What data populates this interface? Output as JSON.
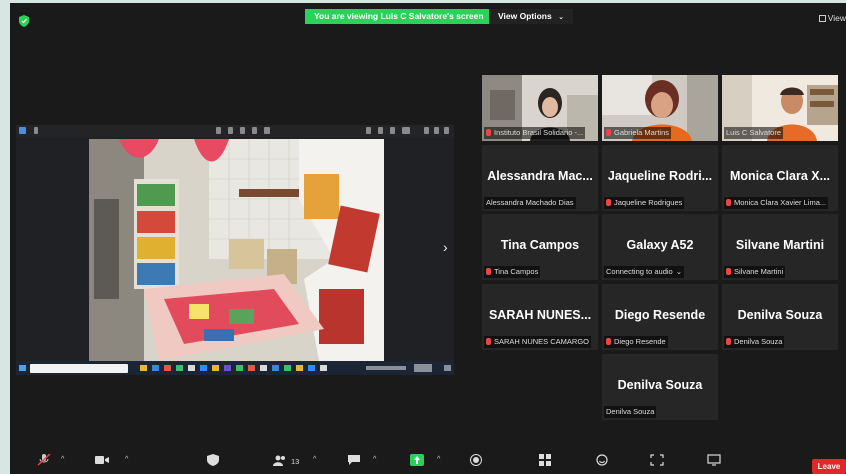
{
  "top_bar": {
    "viewing_banner": "You are viewing Luis C Salvatore's screen",
    "view_options": "View Options",
    "view_button": "View"
  },
  "participants": [
    {
      "big_name": "",
      "label": "Instituto Brasil Solidario -...",
      "muted": true,
      "video": true
    },
    {
      "big_name": "",
      "label": "Gabriela Martins",
      "muted": true,
      "video": true
    },
    {
      "big_name": "",
      "label": "Luis C Salvatore",
      "muted": false,
      "video": true,
      "active": true
    },
    {
      "big_name": "Alessandra Mac...",
      "label": "Alessandra Machado Dias",
      "muted": false
    },
    {
      "big_name": "Jaqueline Rodri...",
      "label": "Jaqueline Rodrigues",
      "muted": true
    },
    {
      "big_name": "Monica Clara X...",
      "label": "Monica Clara Xavier Lima...",
      "muted": true
    },
    {
      "big_name": "Tina Campos",
      "label": "Tina Campos",
      "muted": true
    },
    {
      "big_name": "Galaxy A52",
      "label": "Connecting to audio",
      "muted": false
    },
    {
      "big_name": "Silvane Martini",
      "label": "Silvane Martini",
      "muted": true
    },
    {
      "big_name": "SARAH NUNES...",
      "label": "SARAH NUNES CAMARGO",
      "muted": true
    },
    {
      "big_name": "Diego Resende",
      "label": "Diego Resende",
      "muted": true
    },
    {
      "big_name": "Denilva Souza",
      "label": "Denilva Souza",
      "muted": true
    },
    {
      "big_name": "Denilva Souza",
      "label": "Denilva Souza",
      "muted": false
    }
  ],
  "bottom_bar": {
    "participant_count": "13",
    "leave_label": "Leave"
  },
  "colors": {
    "share_banner": "#2ad15a",
    "active_speaker": "#c8d935",
    "leave": "#e02828",
    "muted_mic": "#e44444"
  }
}
